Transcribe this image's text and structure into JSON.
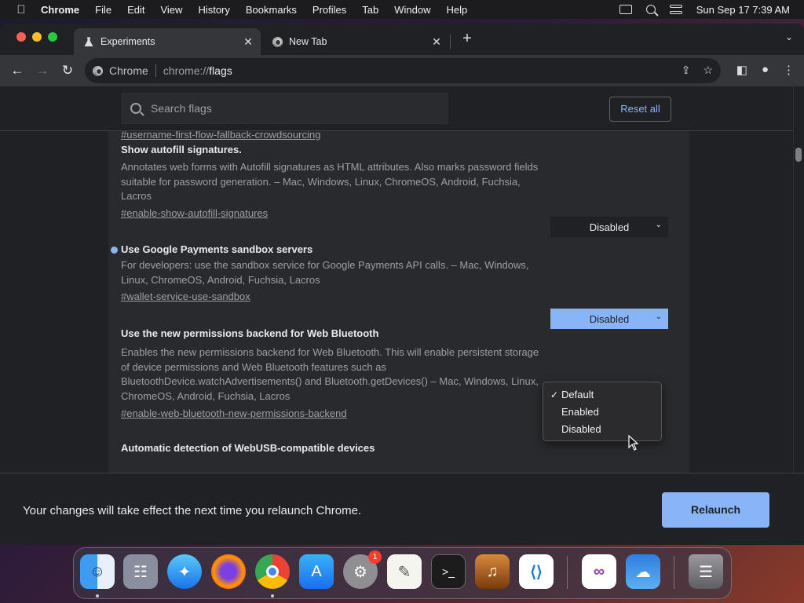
{
  "menubar": {
    "app": "Chrome",
    "items": [
      "File",
      "Edit",
      "View",
      "History",
      "Bookmarks",
      "Profiles",
      "Tab",
      "Window",
      "Help"
    ],
    "clock": "Sun Sep 17  7:39 AM"
  },
  "tabs": [
    {
      "label": "Experiments",
      "active": true,
      "icon": "flask-icon"
    },
    {
      "label": "New Tab",
      "active": false,
      "icon": "chrome-icon"
    }
  ],
  "omnibox": {
    "site_label": "Chrome",
    "url_scheme": "chrome://",
    "url_host": "flags"
  },
  "search": {
    "placeholder": "Search flags",
    "reset_label": "Reset all"
  },
  "flags": {
    "prev_link": "#username-first-flow-fallback-crowdsourcing",
    "f1": {
      "title": "Show autofill signatures.",
      "desc": "Annotates web forms with Autofill signatures as HTML attributes. Also marks password fields suitable for password generation. – Mac, Windows, Linux, ChromeOS, Android, Fuchsia, Lacros",
      "link": "#enable-show-autofill-signatures",
      "value": "Disabled"
    },
    "f2": {
      "title": "Use Google Payments sandbox servers",
      "desc": "For developers: use the sandbox service for Google Payments API calls. – Mac, Windows, Linux, ChromeOS, Android, Fuchsia, Lacros",
      "link": "#wallet-service-use-sandbox",
      "value": "Disabled"
    },
    "f3": {
      "title": "Use the new permissions backend for Web Bluetooth",
      "desc": "Enables the new permissions backend for Web Bluetooth. This will enable persistent storage of device permissions and Web Bluetooth features such as BluetoothDevice.watchAdvertisements() and Bluetooth.getDevices() – Mac, Windows, Linux, ChromeOS, Android, Fuchsia, Lacros",
      "link": "#enable-web-bluetooth-new-permissions-backend"
    },
    "f4": {
      "title": "Automatic detection of WebUSB-compatible devices"
    }
  },
  "dropdown": {
    "options": [
      "Default",
      "Enabled",
      "Disabled"
    ],
    "checked": "Default"
  },
  "bottom": {
    "message": "Your changes will take effect the next time you relaunch Chrome.",
    "relaunch_label": "Relaunch"
  },
  "dock": {
    "apps": [
      "finder-icon",
      "launchpad-icon",
      "safari-icon",
      "firefox-icon",
      "chrome-icon",
      "app-store-icon",
      "system-settings-icon",
      "textedit-icon",
      "terminal-icon",
      "garageband-icon",
      "vscode-icon",
      "visual-studio-icon",
      "weather-icon",
      "trash-icon"
    ],
    "settings_badge": "1"
  },
  "colors": {
    "accent": "#8ab4f8",
    "background": "#202124",
    "panel": "#292a2d"
  }
}
